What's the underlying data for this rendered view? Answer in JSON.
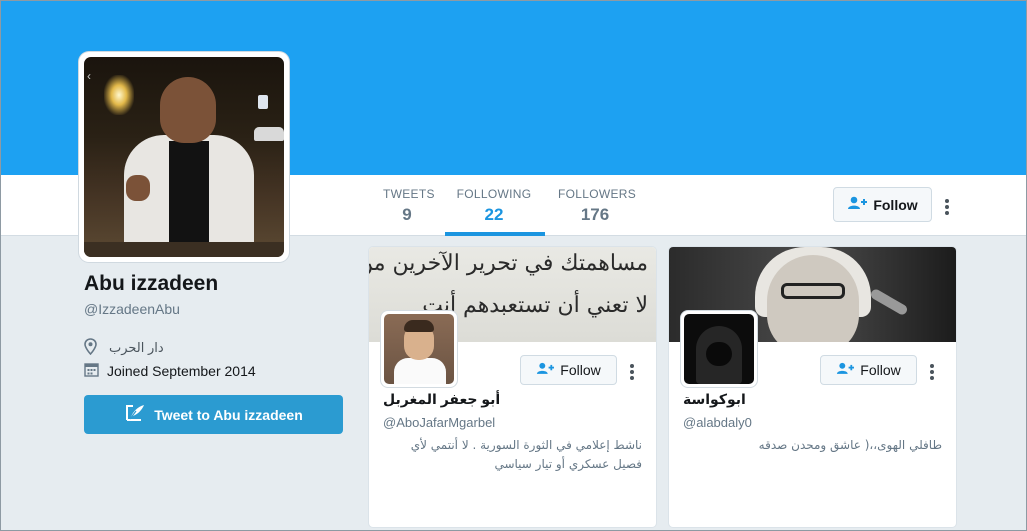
{
  "profile": {
    "name": "Abu izzadeen",
    "handle": "@IzzadeenAbu",
    "location": "دار الحرب",
    "joined": "Joined September 2014",
    "tweet_to_label": "Tweet to Abu izzadeen"
  },
  "stats": [
    {
      "label": "TWEETS",
      "value": "9",
      "active": false
    },
    {
      "label": "FOLLOWING",
      "value": "22",
      "active": true
    },
    {
      "label": "FOLLOWERS",
      "value": "176",
      "active": false
    }
  ],
  "header_follow_label": "Follow",
  "cards": [
    {
      "banner_line1": "مساهمتك في تحرير الآخرين من العبودية",
      "banner_line2": "لا تعني أن تستعبدهم أنت",
      "name": "أبو جعفر المغربل",
      "handle": "@AboJafarMgarbel",
      "bio": "ناشط إعلامي في الثورة السورية . لا أنتمي لأي فصيل عسكري أو تيار سياسي",
      "follow_label": "Follow"
    },
    {
      "name": "ابوكواسة",
      "handle": "@alabdaly0",
      "bio": "طافلي الهوى،،( عاشق ومحدن صدقه",
      "follow_label": "Follow"
    }
  ],
  "colors": {
    "banner": "#1da1f2",
    "accent": "#1b95e0",
    "tweet_button": "#2b9bd1"
  },
  "icons": [
    "location-pin-icon",
    "calendar-icon",
    "compose-icon",
    "follow-person-icon",
    "more-options-icon"
  ]
}
